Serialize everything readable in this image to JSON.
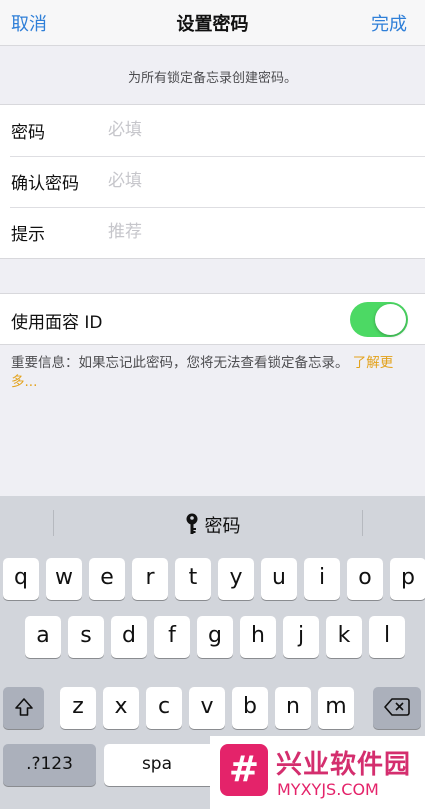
{
  "navbar": {
    "cancel": "取消",
    "title": "设置密码",
    "done": "完成"
  },
  "header_note": "为所有锁定备忘录创建密码。",
  "form": {
    "rows": [
      {
        "label": "密码",
        "placeholder": "必填"
      },
      {
        "label": "确认密码",
        "placeholder": "必填"
      },
      {
        "label": "提示",
        "placeholder": "推荐"
      }
    ]
  },
  "faceid": {
    "label": "使用面容 ID",
    "enabled": true,
    "toggle_color": "#4cd964"
  },
  "footer_note": {
    "text": "重要信息：如果忘记此密码，您将无法查看锁定备忘录。",
    "link": "了解更多..."
  },
  "keyboard": {
    "suggestion": {
      "icon": "key-icon",
      "label": "密码"
    },
    "row1": [
      "q",
      "w",
      "e",
      "r",
      "t",
      "y",
      "u",
      "i",
      "o",
      "p"
    ],
    "row2": [
      "a",
      "s",
      "d",
      "f",
      "g",
      "h",
      "j",
      "k",
      "l"
    ],
    "row3": [
      "z",
      "x",
      "c",
      "v",
      "b",
      "n",
      "m"
    ],
    "shift_icon": "shift-icon",
    "delete_icon": "delete-icon",
    "numbers_label": ".?123",
    "space_label": "spa"
  },
  "watermark": {
    "logo": "#",
    "name": "兴业软件园",
    "url": "MYXYJS.COM"
  },
  "colors": {
    "accent": "#2f7fd8",
    "link": "#e3a21b",
    "brand": "#e4236a"
  }
}
